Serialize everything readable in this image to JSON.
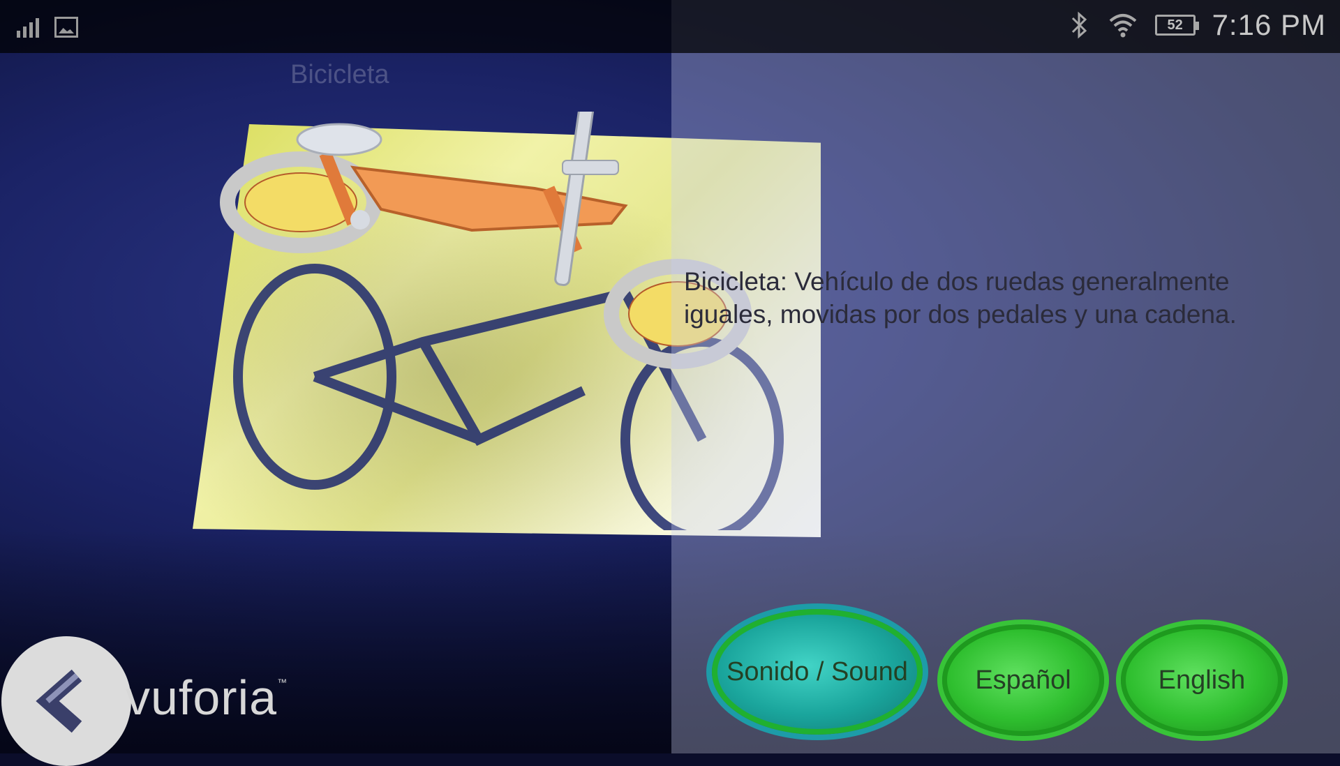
{
  "status_bar": {
    "clock": "7:16 PM",
    "battery_level": "52",
    "icons": [
      "signal-icon",
      "gallery-icon",
      "bluetooth-icon",
      "wifi-icon",
      "battery-icon"
    ]
  },
  "scene": {
    "title": "Bicicleta",
    "description": "Bicicleta: Vehículo de dos ruedas generalmente iguales, movidas por dos pedales y una cadena."
  },
  "buttons": {
    "sound": "Sonido / Sound",
    "spanish": "Español",
    "english": "English"
  },
  "watermark": {
    "text": "vuforia",
    "trademark": "™"
  },
  "colors": {
    "accent_green": "#2fbf2f",
    "accent_teal": "#1aa59c",
    "overlay": "#c8cdf0"
  }
}
